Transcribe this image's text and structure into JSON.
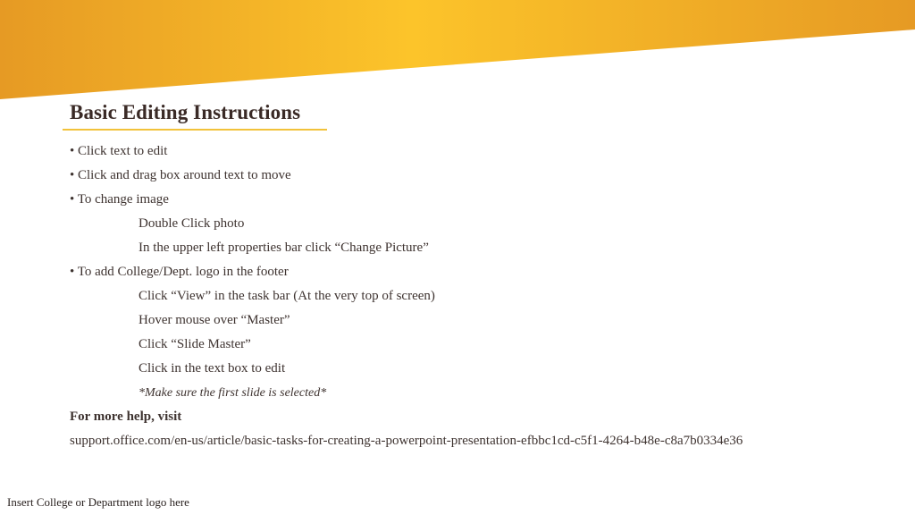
{
  "colors": {
    "banner_left": "#e69a24",
    "banner_mid": "#fcc42a",
    "banner_right": "#e69a24",
    "title": "#3a2a26",
    "title_rule": "#f2c23a",
    "body_text": "#3e3330"
  },
  "slide": {
    "title": "Basic Editing Instructions",
    "instructions": [
      "• Click text to edit",
      "• Click and drag box around text to move",
      "• To change image",
      "Double Click photo",
      "In the upper left properties bar click “Change Picture”",
      "• To add College/Dept. logo in the footer",
      "Click “View” in the task bar (At the very top of screen)",
      "Hover mouse over “Master”",
      "Click “Slide Master”",
      "Click in the text box to edit",
      "*Make sure the first slide is selected*"
    ],
    "help_label": "For more help, visit",
    "help_url": "support.office.com/en-us/article/basic-tasks-for-creating-a-powerpoint-presentation-efbbc1cd-c5f1-4264-b48e-c8a7b0334e36",
    "footer": "Insert College or Department logo here"
  }
}
